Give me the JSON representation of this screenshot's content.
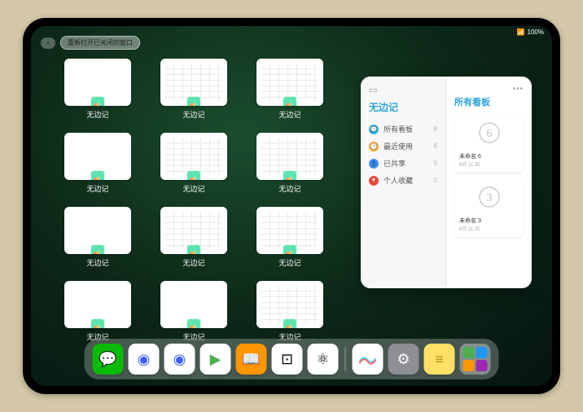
{
  "status": {
    "wifi": "📶",
    "battery": "100%"
  },
  "topbar": {
    "add_label": "+",
    "reopen_label": "重新打开已关闭的窗口"
  },
  "windows": [
    {
      "label": "无边记",
      "type": "empty"
    },
    {
      "label": "无边记",
      "type": "cal"
    },
    {
      "label": "无边记",
      "type": "cal"
    },
    {
      "label": "无边记",
      "type": "empty"
    },
    {
      "label": "无边记",
      "type": "cal"
    },
    {
      "label": "无边记",
      "type": "cal"
    },
    {
      "label": "无边记",
      "type": "empty"
    },
    {
      "label": "无边记",
      "type": "cal"
    },
    {
      "label": "无边记",
      "type": "cal"
    },
    {
      "label": "无边记",
      "type": "empty"
    },
    {
      "label": "无边记",
      "type": "empty"
    },
    {
      "label": "无边记",
      "type": "cal"
    }
  ],
  "popover": {
    "left_title": "无边记",
    "items": [
      {
        "label": "所有看板",
        "count": "8",
        "color": "#2fb4e8",
        "glyph": "💬"
      },
      {
        "label": "最近使用",
        "count": "8",
        "color": "#f5a623",
        "glyph": "🕑"
      },
      {
        "label": "已共享",
        "count": "0",
        "color": "#4a90e2",
        "glyph": "👤"
      },
      {
        "label": "个人收藏",
        "count": "0",
        "color": "#e94b3c",
        "glyph": "♥"
      }
    ],
    "right_title": "所有看板",
    "boards": [
      {
        "name": "未命名 6",
        "date": "8月 11:35",
        "digit": "6"
      },
      {
        "name": "未命名 3",
        "date": "8月 11:35",
        "digit": "3"
      }
    ]
  },
  "dock": {
    "icons": [
      {
        "name": "wechat",
        "bg": "#09BB07",
        "glyph": "💬"
      },
      {
        "name": "quark1",
        "bg": "#ffffff",
        "glyph": "◉",
        "color": "#3b5fff"
      },
      {
        "name": "quark2",
        "bg": "#ffffff",
        "glyph": "◉",
        "color": "#3b5fff"
      },
      {
        "name": "play",
        "bg": "#ffffff",
        "glyph": "▶",
        "color": "#4caf50"
      },
      {
        "name": "books",
        "bg": "#ff9500",
        "glyph": "📖"
      },
      {
        "name": "dice",
        "bg": "#ffffff",
        "glyph": "⊡",
        "color": "#000"
      },
      {
        "name": "nodes",
        "bg": "#ffffff",
        "glyph": "⚛",
        "color": "#000"
      }
    ],
    "recent": [
      {
        "name": "freeform",
        "bg": "#ffffff"
      },
      {
        "name": "settings",
        "bg": "#8e8e93",
        "glyph": "⚙",
        "color": "#fff"
      },
      {
        "name": "notes",
        "bg": "#ffe066",
        "glyph": "≡",
        "color": "#b58900"
      }
    ]
  }
}
